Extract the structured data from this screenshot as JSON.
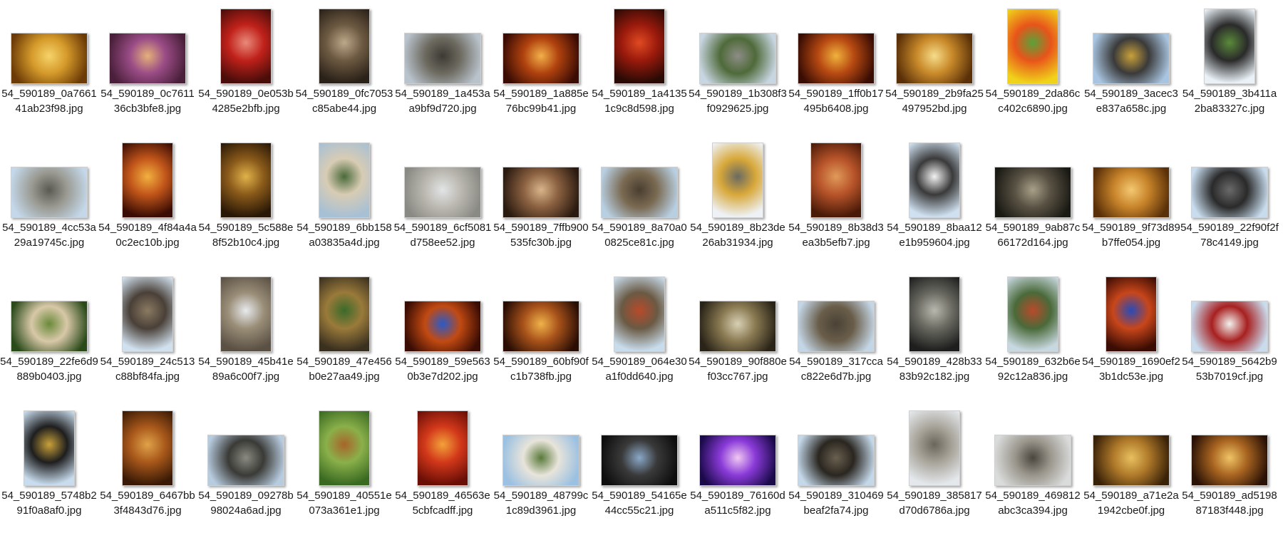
{
  "window": {
    "view": "Large icons"
  },
  "files": [
    {
      "name": "54_590189_0a766141ab23f98.jpg",
      "orientation": "landscape",
      "colors": [
        "#6b3a06",
        "#d59a2a",
        "#f6d36a"
      ]
    },
    {
      "name": "54_590189_0c761136cb3bfe8.jpg",
      "orientation": "landscape",
      "colors": [
        "#4a1f3a",
        "#9a4c86",
        "#e5b07a"
      ]
    },
    {
      "name": "54_590189_0e053b4285e2bfb.jpg",
      "orientation": "portrait",
      "colors": [
        "#4a0d0a",
        "#c0211a",
        "#e88a7a"
      ]
    },
    {
      "name": "54_590189_0fc7053c85abe44.jpg",
      "orientation": "portrait",
      "colors": [
        "#2a2118",
        "#6d5a42",
        "#bca88a"
      ]
    },
    {
      "name": "54_590189_1a453aa9bf9d720.jpg",
      "orientation": "landscape",
      "colors": [
        "#b9c3cc",
        "#6d6a60",
        "#3d3a34"
      ]
    },
    {
      "name": "54_590189_1a885e76bc99b41.jpg",
      "orientation": "landscape",
      "colors": [
        "#3a0c04",
        "#b0420e",
        "#f2b04a"
      ]
    },
    {
      "name": "54_590189_1a41351c9c8d598.jpg",
      "orientation": "portrait",
      "colors": [
        "#2a0a05",
        "#9a1a0c",
        "#e04a22"
      ]
    },
    {
      "name": "54_590189_1b308f3f0929625.jpg",
      "orientation": "landscape",
      "colors": [
        "#c8d6e2",
        "#4f6a3a",
        "#8d8d86"
      ]
    },
    {
      "name": "54_590189_1ff0b17495b6408.jpg",
      "orientation": "landscape",
      "colors": [
        "#3a0d03",
        "#b84a12",
        "#f0b23c"
      ]
    },
    {
      "name": "54_590189_2b9fa25497952bd.jpg",
      "orientation": "landscape",
      "colors": [
        "#5a3008",
        "#c98a2a",
        "#f6dc8a"
      ]
    },
    {
      "name": "54_590189_2da86cc402c6890.jpg",
      "orientation": "portrait",
      "colors": [
        "#f0d21a",
        "#e8541a",
        "#5aa23a"
      ]
    },
    {
      "name": "54_590189_3acec3e837a658c.jpg",
      "orientation": "landscape",
      "colors": [
        "#a8c4e0",
        "#3a3a3a",
        "#c9a13a"
      ]
    },
    {
      "name": "54_590189_3b411a2ba83327c.jpg",
      "orientation": "portrait",
      "colors": [
        "#eaf2f8",
        "#2a2a2a",
        "#5a8a3a"
      ]
    },
    {
      "name": "54_590189_4cc53a29a19745c.jpg",
      "orientation": "landscape",
      "colors": [
        "#c4d8ea",
        "#9a9a92",
        "#5a5a52"
      ]
    },
    {
      "name": "54_590189_4f84a4a0c2ec10b.jpg",
      "orientation": "portrait",
      "colors": [
        "#3a0c03",
        "#c2561a",
        "#f2b040"
      ]
    },
    {
      "name": "54_590189_5c588e8f52b10c4.jpg",
      "orientation": "portrait",
      "colors": [
        "#2a1806",
        "#8a5a1a",
        "#e0b24a"
      ]
    },
    {
      "name": "54_590189_6bb158a03835a4d.jpg",
      "orientation": "portrait",
      "colors": [
        "#a8c0d4",
        "#d8ccb4",
        "#4a6a3a"
      ]
    },
    {
      "name": "54_590189_6cf5081d758ee52.jpg",
      "orientation": "landscape",
      "colors": [
        "#8a8a84",
        "#bcbab2",
        "#e2e4e6"
      ]
    },
    {
      "name": "54_590189_7ffb900535fc30b.jpg",
      "orientation": "landscape",
      "colors": [
        "#2a1a10",
        "#8a6040",
        "#d8b48a"
      ]
    },
    {
      "name": "54_590189_8a70a00825ce81c.jpg",
      "orientation": "landscape",
      "colors": [
        "#b8cfe2",
        "#7a6a52",
        "#4a3e30"
      ]
    },
    {
      "name": "54_590189_8b23de26ab31934.jpg",
      "orientation": "portrait",
      "colors": [
        "#eef2f6",
        "#d8a83a",
        "#6a6a62"
      ]
    },
    {
      "name": "54_590189_8b38d3ea3b5efb7.jpg",
      "orientation": "portrait",
      "colors": [
        "#4a1a08",
        "#b8542a",
        "#e09a5a"
      ]
    },
    {
      "name": "54_590189_8baa12e1b959604.jpg",
      "orientation": "portrait",
      "colors": [
        "#cfe0f0",
        "#3a3a3a",
        "#f2f2f2"
      ]
    },
    {
      "name": "54_590189_9ab87c66172d164.jpg",
      "orientation": "landscape",
      "colors": [
        "#1a1a14",
        "#5a5244",
        "#a8a088"
      ]
    },
    {
      "name": "54_590189_9f73d89b7ffe054.jpg",
      "orientation": "landscape",
      "colors": [
        "#5a3008",
        "#c8842a",
        "#f4c872"
      ]
    },
    {
      "name": "54_590189_22f90f2f78c4149.jpg",
      "orientation": "landscape",
      "colors": [
        "#c8dcee",
        "#2a2a2a",
        "#6a6a6a"
      ]
    },
    {
      "name": "54_590189_22fe6d9889b0403.jpg",
      "orientation": "landscape",
      "colors": [
        "#2a4a1a",
        "#d8c8a8",
        "#6a8a3a"
      ]
    },
    {
      "name": "54_590189_24c513c88bf84fa.jpg",
      "orientation": "portrait",
      "colors": [
        "#d0e0ee",
        "#4a4038",
        "#8a7a62"
      ]
    },
    {
      "name": "54_590189_45b41e89a6c00f7.jpg",
      "orientation": "portrait",
      "colors": [
        "#5a5044",
        "#9a8e78",
        "#e8eaee"
      ]
    },
    {
      "name": "54_590189_47e456b0e27aa49.jpg",
      "orientation": "portrait",
      "colors": [
        "#3a3020",
        "#9a7a3a",
        "#3a6a2a"
      ]
    },
    {
      "name": "54_590189_59e5630b3e7d202.jpg",
      "orientation": "landscape",
      "colors": [
        "#3a0c03",
        "#c24a12",
        "#2a5ac8"
      ]
    },
    {
      "name": "54_590189_60bf90fc1b738fb.jpg",
      "orientation": "landscape",
      "colors": [
        "#2a0e04",
        "#a8521a",
        "#f0b24a"
      ]
    },
    {
      "name": "54_590189_064e30a1f0dd640.jpg",
      "orientation": "portrait",
      "colors": [
        "#c8dcec",
        "#6a5a44",
        "#b84a2a"
      ]
    },
    {
      "name": "54_590189_90f880ef03cc767.jpg",
      "orientation": "landscape",
      "colors": [
        "#2a2418",
        "#8a7a52",
        "#d8d0b4"
      ]
    },
    {
      "name": "54_590189_317ccac822e6d7b.jpg",
      "orientation": "landscape",
      "colors": [
        "#c4d6e6",
        "#6a5e4a",
        "#4a4236"
      ]
    },
    {
      "name": "54_590189_428b3383b92c182.jpg",
      "orientation": "portrait",
      "colors": [
        "#1e1e1e",
        "#6a6a62",
        "#b8b8ae"
      ]
    },
    {
      "name": "54_590189_632b6e92c12a836.jpg",
      "orientation": "portrait",
      "colors": [
        "#c8d8e0",
        "#4a6a3a",
        "#b84a2a"
      ]
    },
    {
      "name": "54_590189_1690ef23b1dc53e.jpg",
      "orientation": "portrait",
      "colors": [
        "#3a0c03",
        "#c8461a",
        "#2a4ab8"
      ]
    },
    {
      "name": "54_590189_5642b953b7019cf.jpg",
      "orientation": "landscape",
      "colors": [
        "#c8dcee",
        "#a82020",
        "#f2f2ee"
      ]
    },
    {
      "name": "54_590189_5748b291f0a8af0.jpg",
      "orientation": "portrait",
      "colors": [
        "#c8dcee",
        "#1e1e1e",
        "#c9a13a"
      ]
    },
    {
      "name": "54_590189_6467bb3f4843d76.jpg",
      "orientation": "portrait",
      "colors": [
        "#3a1a06",
        "#a8581a",
        "#e0a24a"
      ]
    },
    {
      "name": "54_590189_09278b98024a6ad.jpg",
      "orientation": "landscape",
      "colors": [
        "#b8cce0",
        "#3a3a36",
        "#8a8a82"
      ]
    },
    {
      "name": "54_590189_40551e073a361e1.jpg",
      "orientation": "portrait",
      "colors": [
        "#3a6a22",
        "#8ab04a",
        "#a8642a"
      ]
    },
    {
      "name": "54_590189_46563e5cbfcadff.jpg",
      "orientation": "portrait",
      "colors": [
        "#6a0e06",
        "#d2381a",
        "#f2a23a"
      ]
    },
    {
      "name": "54_590189_48799c1c89d3961.jpg",
      "orientation": "landscape",
      "colors": [
        "#9ac0e2",
        "#e8e4da",
        "#5a7a3a"
      ]
    },
    {
      "name": "54_590189_54165e44cc55c21.jpg",
      "orientation": "landscape",
      "colors": [
        "#0e0e0e",
        "#3a3a3a",
        "#8aa8c8"
      ]
    },
    {
      "name": "54_590189_76160da511c5f82.jpg",
      "orientation": "landscape",
      "colors": [
        "#1a0a4a",
        "#8a3ad8",
        "#f0c8f2"
      ]
    },
    {
      "name": "54_590189_310469beaf2fa74.jpg",
      "orientation": "landscape",
      "colors": [
        "#c4d8ea",
        "#2a2620",
        "#6a6050"
      ]
    },
    {
      "name": "54_590189_385817d70d6786a.jpg",
      "orientation": "portrait",
      "colors": [
        "#e4e8ec",
        "#a8a49a",
        "#6a665c"
      ]
    },
    {
      "name": "54_590189_469812abc3ca394.jpg",
      "orientation": "landscape",
      "colors": [
        "#dadcdc",
        "#9a968c",
        "#4a463e"
      ]
    },
    {
      "name": "54_590189_a71e2a1942cbe0f.jpg",
      "orientation": "landscape",
      "colors": [
        "#3a2208",
        "#b07a2a",
        "#e8c060"
      ]
    },
    {
      "name": "54_590189_ad519887183f448.jpg",
      "orientation": "landscape",
      "colors": [
        "#2a1206",
        "#a86420",
        "#f0c466"
      ]
    }
  ]
}
